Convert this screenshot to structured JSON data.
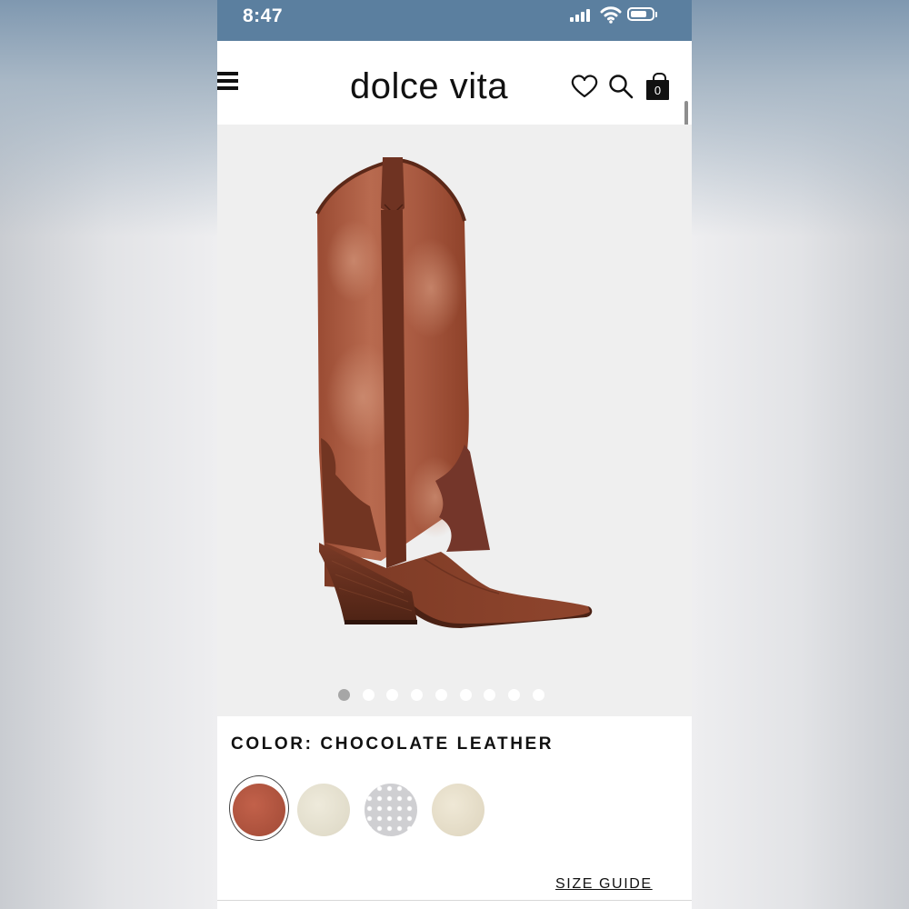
{
  "status_bar": {
    "time": "8:47"
  },
  "header": {
    "brand": "dolce vita",
    "cart_count": "0"
  },
  "product": {
    "image_count": 9,
    "active_image": 1
  },
  "color": {
    "label": "COLOR: CHOCOLATE LEATHER",
    "swatches": [
      {
        "name": "chocolate-leather",
        "color": "#b0533f",
        "selected": true
      },
      {
        "name": "cream",
        "color": "#e6e2d2"
      },
      {
        "name": "pearl",
        "color": "#d9d9db"
      },
      {
        "name": "ivory",
        "color": "#e8e0cc"
      }
    ]
  },
  "size_guide": "SIZE GUIDE",
  "colors": {
    "status_bar": "#5b7f9f",
    "boot_shaft": "#a4553e",
    "boot_dark": "#6e3422"
  }
}
